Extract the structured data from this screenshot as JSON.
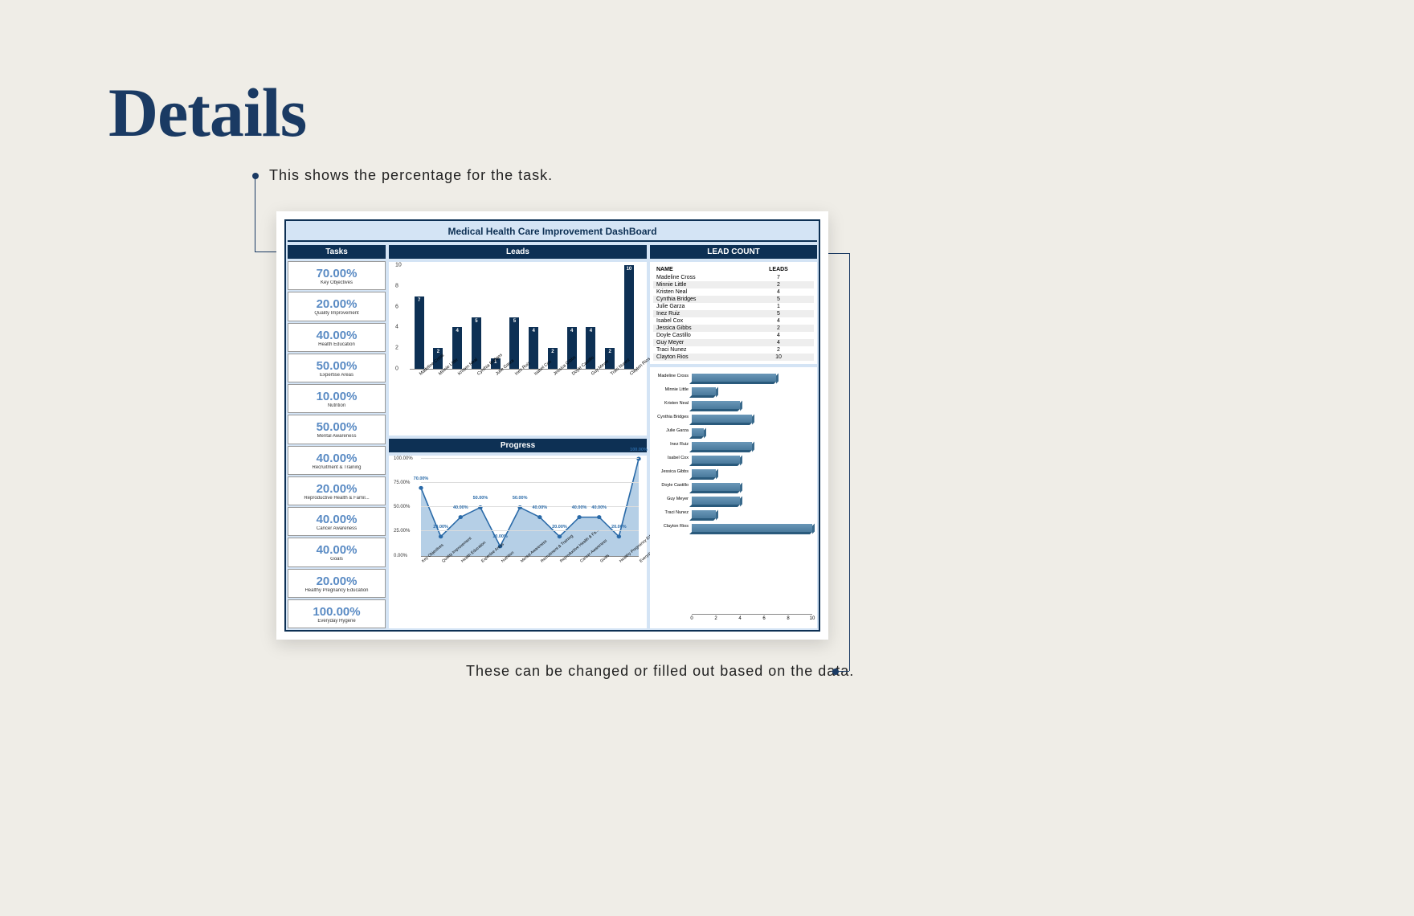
{
  "page_title": "Details",
  "annotation_top": "This shows the percentage for the task.",
  "annotation_bottom": "These can be changed or filled out based on the data.",
  "dashboard_title": "Medical Health Care Improvement DashBoard",
  "headers": {
    "tasks": "Tasks",
    "leads": "Leads",
    "progress": "Progress",
    "lead_count": "LEAD COUNT"
  },
  "lead_table_headers": {
    "name": "NAME",
    "leads": "LEADS"
  },
  "tasks": [
    {
      "pct": "70.00%",
      "label": "Key Objectives"
    },
    {
      "pct": "20.00%",
      "label": "Quality Improvement"
    },
    {
      "pct": "40.00%",
      "label": "Health Education"
    },
    {
      "pct": "50.00%",
      "label": "Expertise Areas"
    },
    {
      "pct": "10.00%",
      "label": "Nutrition"
    },
    {
      "pct": "50.00%",
      "label": "Mental Awareness"
    },
    {
      "pct": "40.00%",
      "label": "Recruitment & Training"
    },
    {
      "pct": "20.00%",
      "label": "Reproductive Health & Famil..."
    },
    {
      "pct": "40.00%",
      "label": "Cancer Awareness"
    },
    {
      "pct": "40.00%",
      "label": "Goals"
    },
    {
      "pct": "20.00%",
      "label": "Healthy Pregnancy Education"
    },
    {
      "pct": "100.00%",
      "label": "Everyday Hygene"
    }
  ],
  "lead_names": [
    "Madeline Cross",
    "Minnie Little",
    "Kristen Neal",
    "Cynthia Bridges",
    "Julie Garza",
    "Inez Ruiz",
    "Isabel Cox",
    "Jessica Gibbs",
    "Doyle Castillo",
    "Guy Meyer",
    "Traci Nunez",
    "Clayton Rios"
  ],
  "lead_values": [
    7,
    2,
    4,
    5,
    1,
    5,
    4,
    2,
    4,
    4,
    2,
    10
  ],
  "progress_labels": [
    "Key Objectives",
    "Quality Improvement",
    "Health Education",
    "Expertise Areas",
    "Nutrition",
    "Mental Awareness",
    "Recruitment & Training",
    "Reproductive Health & Fa...",
    "Cancer Awareness",
    "Goals",
    "Healthy Pregnancy Educa...",
    "Everyday Hygene"
  ],
  "chart_data": [
    {
      "type": "bar",
      "title": "Leads",
      "categories": [
        "Madeline Cross",
        "Minnie Little",
        "Kristen Neal",
        "Cynthia Bridges",
        "Julie Garza",
        "Inez Ruiz",
        "Isabel Cox",
        "Jessica Gibbs",
        "Doyle Castillo",
        "Guy Meyer",
        "Traci Nunez",
        "Clayton Rios"
      ],
      "values": [
        7,
        2,
        4,
        5,
        1,
        5,
        4,
        2,
        4,
        4,
        2,
        10
      ],
      "ylim": [
        0,
        10
      ],
      "yticks": [
        0,
        2,
        4,
        6,
        8,
        10
      ],
      "xlabel": "",
      "ylabel": ""
    },
    {
      "type": "area",
      "title": "Progress",
      "categories": [
        "Key Objectives",
        "Quality Improvement",
        "Health Education",
        "Expertise Areas",
        "Nutrition",
        "Mental Awareness",
        "Recruitment & Training",
        "Reproductive Health & Fa...",
        "Cancer Awareness",
        "Goals",
        "Healthy Pregnancy Educa...",
        "Everyday Hygene"
      ],
      "values": [
        70,
        20,
        40,
        50,
        10,
        50,
        40,
        20,
        40,
        40,
        20,
        100
      ],
      "value_labels": [
        "70.00%",
        "20.00%",
        "40.00%",
        "50.00%",
        "10.00%",
        "50.00%",
        "40.00%",
        "20.00%",
        "40.00%",
        "40.00%",
        "20.00%",
        "100.00%"
      ],
      "ylim": [
        0,
        100
      ],
      "yticks": [
        "0.00%",
        "25.00%",
        "50.00%",
        "75.00%",
        "100.00%"
      ],
      "xlabel": "",
      "ylabel": ""
    },
    {
      "type": "bar",
      "orientation": "horizontal",
      "title": "LEAD COUNT",
      "categories": [
        "Madeline Cross",
        "Minnie Little",
        "Kristen Neal",
        "Cynthia Bridges",
        "Julie Garza",
        "Inez Ruiz",
        "Isabel Cox",
        "Jessica Gibbs",
        "Doyle Castillo",
        "Guy Meyer",
        "Traci Nunez",
        "Clayton Rios"
      ],
      "values": [
        7,
        2,
        4,
        5,
        1,
        5,
        4,
        2,
        4,
        4,
        2,
        10
      ],
      "xlim": [
        0,
        10
      ],
      "xticks": [
        0,
        2,
        4,
        6,
        8,
        10
      ],
      "xlabel": "",
      "ylabel": ""
    }
  ]
}
